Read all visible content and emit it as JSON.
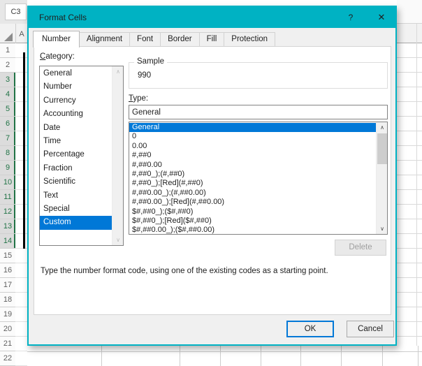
{
  "excel": {
    "name_box": "C3",
    "column_header": "A",
    "rows": [
      {
        "n": "1",
        "sel": false
      },
      {
        "n": "2",
        "sel": false
      },
      {
        "n": "3",
        "sel": true
      },
      {
        "n": "4",
        "sel": true
      },
      {
        "n": "5",
        "sel": true
      },
      {
        "n": "6",
        "sel": true
      },
      {
        "n": "7",
        "sel": true
      },
      {
        "n": "8",
        "sel": true
      },
      {
        "n": "9",
        "sel": true
      },
      {
        "n": "10",
        "sel": true
      },
      {
        "n": "11",
        "sel": true
      },
      {
        "n": "12",
        "sel": true
      },
      {
        "n": "13",
        "sel": true
      },
      {
        "n": "14",
        "sel": true
      },
      {
        "n": "15",
        "sel": false
      },
      {
        "n": "16",
        "sel": false
      },
      {
        "n": "17",
        "sel": false
      },
      {
        "n": "18",
        "sel": false
      },
      {
        "n": "19",
        "sel": false
      },
      {
        "n": "20",
        "sel": false
      },
      {
        "n": "21",
        "sel": false
      },
      {
        "n": "22",
        "sel": false
      }
    ]
  },
  "dialog": {
    "title": "Format Cells",
    "help_label": "?",
    "close_label": "✕",
    "tabs": [
      {
        "label": "Number",
        "active": true
      },
      {
        "label": "Alignment",
        "active": false
      },
      {
        "label": "Font",
        "active": false
      },
      {
        "label": "Border",
        "active": false
      },
      {
        "label": "Fill",
        "active": false
      },
      {
        "label": "Protection",
        "active": false
      }
    ],
    "category": {
      "label": "Category:",
      "items": [
        {
          "label": "General",
          "selected": false
        },
        {
          "label": "Number",
          "selected": false
        },
        {
          "label": "Currency",
          "selected": false
        },
        {
          "label": "Accounting",
          "selected": false
        },
        {
          "label": "Date",
          "selected": false
        },
        {
          "label": "Time",
          "selected": false
        },
        {
          "label": "Percentage",
          "selected": false
        },
        {
          "label": "Fraction",
          "selected": false
        },
        {
          "label": "Scientific",
          "selected": false
        },
        {
          "label": "Text",
          "selected": false
        },
        {
          "label": "Special",
          "selected": false
        },
        {
          "label": "Custom",
          "selected": true
        }
      ]
    },
    "sample": {
      "label": "Sample",
      "value": "990"
    },
    "type": {
      "label": "Type:",
      "value": "General",
      "items": [
        {
          "label": "General",
          "selected": true
        },
        {
          "label": "0",
          "selected": false
        },
        {
          "label": "0.00",
          "selected": false
        },
        {
          "label": "#,##0",
          "selected": false
        },
        {
          "label": "#,##0.00",
          "selected": false
        },
        {
          "label": "#,##0_);(#,##0)",
          "selected": false
        },
        {
          "label": "#,##0_);[Red](#,##0)",
          "selected": false
        },
        {
          "label": "#,##0.00_);(#,##0.00)",
          "selected": false
        },
        {
          "label": "#,##0.00_);[Red](#,##0.00)",
          "selected": false
        },
        {
          "label": "$#,##0_);($#,##0)",
          "selected": false
        },
        {
          "label": "$#,##0_);[Red]($#,##0)",
          "selected": false
        },
        {
          "label": "$#,##0.00_);($#,##0.00)",
          "selected": false
        }
      ]
    },
    "delete_label": "Delete",
    "instruction": "Type the number format code, using one of the existing codes as a starting point.",
    "ok_label": "OK",
    "cancel_label": "Cancel",
    "scroll_up_glyph": "∧",
    "scroll_down_glyph": "∨"
  },
  "colors": {
    "accent_teal": "#00b2c3",
    "selection_blue": "#0078d7",
    "excel_green": "#217346"
  }
}
